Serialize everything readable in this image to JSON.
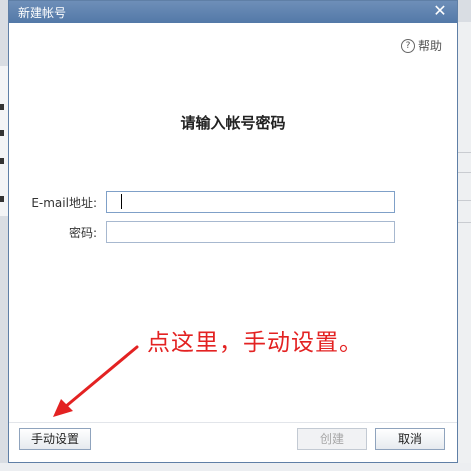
{
  "dialog": {
    "title": "新建帐号",
    "close_glyph": "✕",
    "help_label": "帮助",
    "help_icon": "?",
    "heading": "请输入帐号密码"
  },
  "form": {
    "email_label": "E-mail地址:",
    "email_value": "",
    "password_label": "密码:",
    "password_value": ""
  },
  "annotation": {
    "text": "点这里，手动设置。",
    "color": "#e32222"
  },
  "footer": {
    "manual_button": "手动设置",
    "create_button": "创建",
    "cancel_button": "取消"
  }
}
